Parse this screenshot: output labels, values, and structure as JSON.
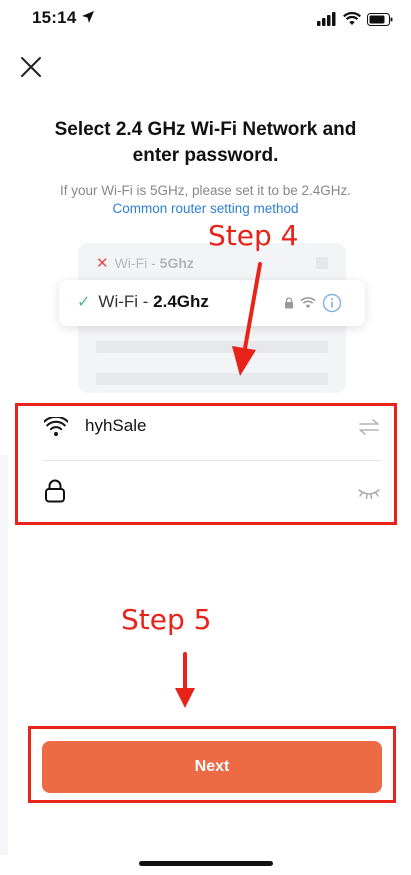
{
  "status_bar": {
    "time": "15:14"
  },
  "header": {
    "close_icon": "close-icon"
  },
  "title": "Select 2.4 GHz Wi-Fi Network and enter password.",
  "subtitle": "If your Wi-Fi is 5GHz, please set it to be 2.4GHz.",
  "router_link": "Common router setting method",
  "illustration": {
    "row_5g_prefix": "Wi-Fi - ",
    "row_5g_band": "5Ghz",
    "row_24_prefix": "Wi-Fi - ",
    "row_24_band": "2.4Ghz"
  },
  "annotations": {
    "step4": "Step 4",
    "step5": "Step 5",
    "color": "#e8231a"
  },
  "wifi_form": {
    "ssid_value": "hyhSale",
    "password_value": "",
    "password_placeholder": ""
  },
  "next_button": {
    "label": "Next",
    "color": "#ec6a44"
  }
}
